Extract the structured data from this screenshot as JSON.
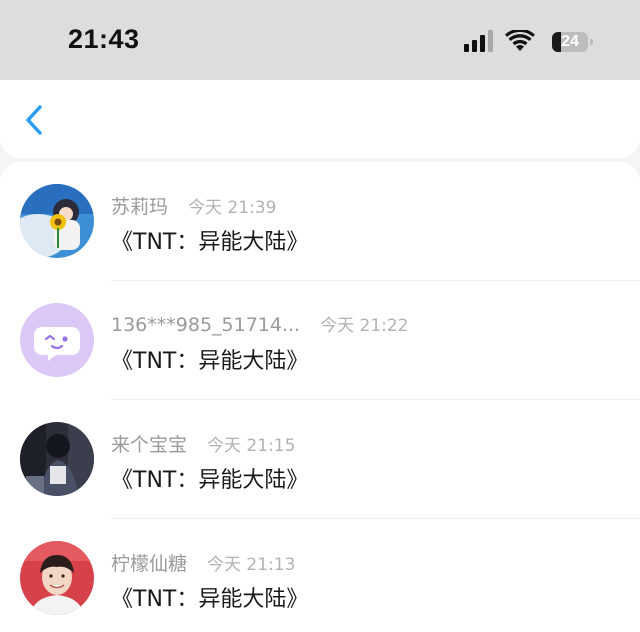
{
  "status_bar": {
    "time": "21:43",
    "battery_level": "24",
    "battery_fraction": 0.24,
    "icons": [
      "signal-icon",
      "wifi-icon",
      "battery-icon"
    ]
  },
  "nav": {
    "back_icon": "chevron-left-icon",
    "accent_color": "#2a9ef2"
  },
  "comments": [
    {
      "name": "苏莉玛",
      "time": "今天 21:39",
      "message": "《TNT：异能大陆》",
      "avatar": "anime-girl-sunflower-avatar"
    },
    {
      "name": "136***985_51714...",
      "time": "今天 21:22",
      "message": "《TNT：异能大陆》",
      "avatar": "default-chat-bubble-avatar"
    },
    {
      "name": "来个宝宝",
      "time": "今天 21:15",
      "message": "《TNT：异能大陆》",
      "avatar": "dark-photo-avatar"
    },
    {
      "name": "柠檬仙糖",
      "time": "今天 21:13",
      "message": "《TNT：异能大陆》",
      "avatar": "smiling-boy-photo-avatar"
    }
  ]
}
